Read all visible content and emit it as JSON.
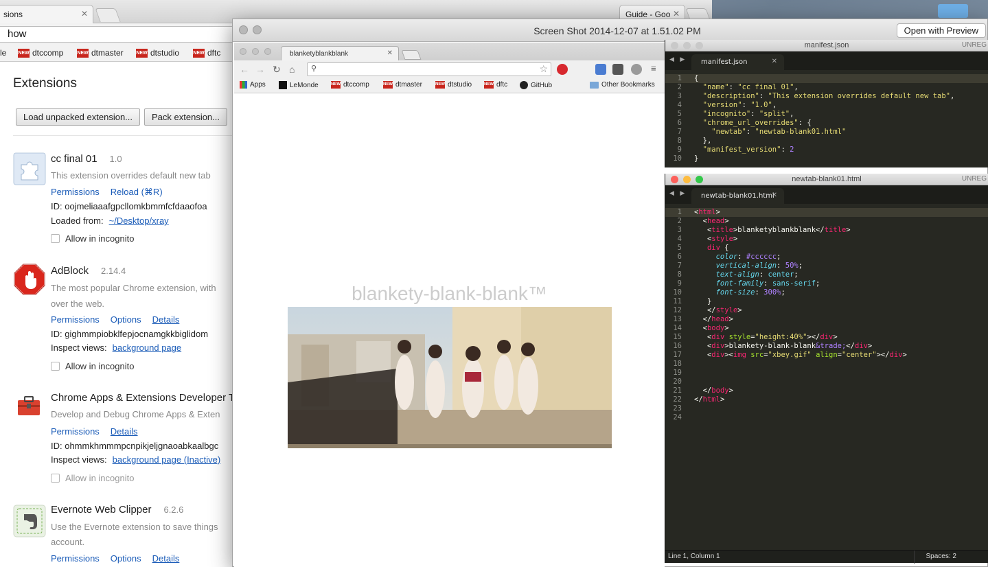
{
  "bg_chrome": {
    "tabs": [
      {
        "label": "sions"
      },
      {
        "label": "Guide - Goo"
      }
    ],
    "omnibox_value": "how",
    "bookmarks": [
      {
        "label": "le",
        "badge": ""
      },
      {
        "label": "dtccomp",
        "badge": "NEW"
      },
      {
        "label": "dtmaster",
        "badge": "NEW"
      },
      {
        "label": "dtstudio",
        "badge": "NEW"
      },
      {
        "label": "dftc",
        "badge": "NEW"
      }
    ]
  },
  "extensions_page": {
    "title": "Extensions",
    "load_unpacked_label": "Load unpacked extension...",
    "pack_label": "Pack extension...",
    "items": [
      {
        "name": "cc final 01",
        "version": "1.0",
        "description": "This extension overrides default new tab",
        "links": [
          "Permissions",
          "Reload (⌘R)"
        ],
        "id_line": "ID: oojmeliaaafgpcllomkbmmfcfdaaofoa",
        "loaded_from_label": "Loaded from:",
        "loaded_from_link": "~/Desktop/xray",
        "incognito_label": "Allow in incognito"
      },
      {
        "name": "AdBlock",
        "version": "2.14.4",
        "description": "The most popular Chrome extension, with",
        "description_2": "over the web.",
        "links": [
          "Permissions",
          "Options",
          "Details"
        ],
        "id_line": "ID: gighmmpiobklfepjocnamgkkbiglidom",
        "inspect_label": "Inspect views:",
        "inspect_link": "background page",
        "incognito_label": "Allow in incognito"
      },
      {
        "name": "Chrome Apps & Extensions Developer T",
        "version": "",
        "description": "Develop and Debug Chrome Apps & Exten",
        "links": [
          "Permissions",
          "Details"
        ],
        "id_line": "ID: ohmmkhmmmpcnpikjeljgnaoabkaalbgc",
        "inspect_label": "Inspect views:",
        "inspect_link": "background page (Inactive)",
        "incognito_label": "Allow in incognito"
      },
      {
        "name": "Evernote Web Clipper",
        "version": "6.2.6",
        "description": "Use the Evernote extension to save things",
        "description_2": "account.",
        "links": [
          "Permissions",
          "Options",
          "Details"
        ]
      }
    ]
  },
  "preview": {
    "title": "Screen Shot 2014-12-07 at 1.51.02 PM",
    "open_with_label": "Open with Preview",
    "inner_chrome": {
      "tab_label": "blanketyblankblank",
      "bookmarks": [
        {
          "label": "Apps",
          "badge": ""
        },
        {
          "label": "LeMonde",
          "badge": ""
        },
        {
          "label": "dtccomp",
          "badge": "NEW"
        },
        {
          "label": "dtmaster",
          "badge": "NEW"
        },
        {
          "label": "dtstudio",
          "badge": "NEW"
        },
        {
          "label": "dftc",
          "badge": "NEW"
        },
        {
          "label": "GitHub",
          "badge": ""
        }
      ],
      "other_bookmarks": "Other Bookmarks",
      "page_text": "blankety-blank-blank™"
    }
  },
  "sublime_manifest": {
    "filename": "manifest.json",
    "unregistered": "UNREG",
    "tab_label": "manifest.json"
  },
  "sublime_html": {
    "filename": "newtab-blank01.html",
    "unregistered": "UNREG",
    "tab_label": "newtab-blank01.html",
    "status_left": "Line 1, Column 1",
    "status_right": "Spaces: 2"
  },
  "colors": {
    "link": "#1b5cb8",
    "sublime_bg": "#272822",
    "tag": "#f92672",
    "string": "#e6db74",
    "number": "#ae81ff"
  }
}
